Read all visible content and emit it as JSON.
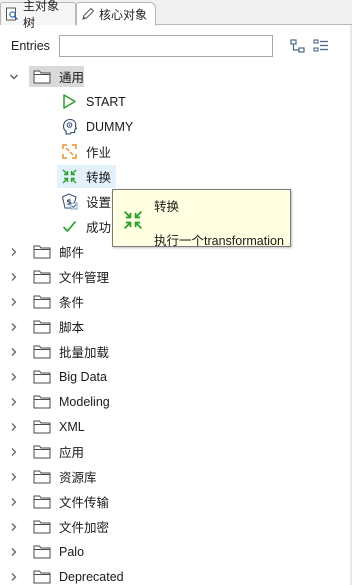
{
  "tabs": [
    {
      "label": "主对象树",
      "icon": "search-tree-icon",
      "active": false
    },
    {
      "label": "核心对象",
      "icon": "pencil-icon",
      "active": true
    }
  ],
  "search": {
    "label": "Entries",
    "value": "",
    "placeholder": ""
  },
  "toolbar": {
    "icons": [
      "tree-view-icon",
      "list-view-icon"
    ]
  },
  "tree": {
    "general": {
      "label": "通用",
      "expanded": true,
      "children": [
        {
          "label": "START",
          "icon": "play-icon"
        },
        {
          "label": "DUMMY",
          "icon": "dummy-head-icon"
        },
        {
          "label": "作业",
          "icon": "job-icon"
        },
        {
          "label": "转换",
          "icon": "transformation-icon"
        },
        {
          "label": "设置变量",
          "icon": "set-variables-icon"
        },
        {
          "label": "成功",
          "icon": "checkmark-icon"
        }
      ]
    },
    "folders": [
      "邮件",
      "文件管理",
      "条件",
      "脚本",
      "批量加载",
      "Big Data",
      "Modeling",
      "XML",
      "应用",
      "资源库",
      "文件传输",
      "文件加密",
      "Palo",
      "Deprecated"
    ]
  },
  "tooltip": {
    "title": "转换",
    "description": "执行一个transformation",
    "icon": "transformation-icon"
  },
  "colors": {
    "selected": "#d9d9d9",
    "hover": "#e3f1fb",
    "tooltip_bg": "#ffffe1",
    "accent_green": "#2ca02c"
  }
}
